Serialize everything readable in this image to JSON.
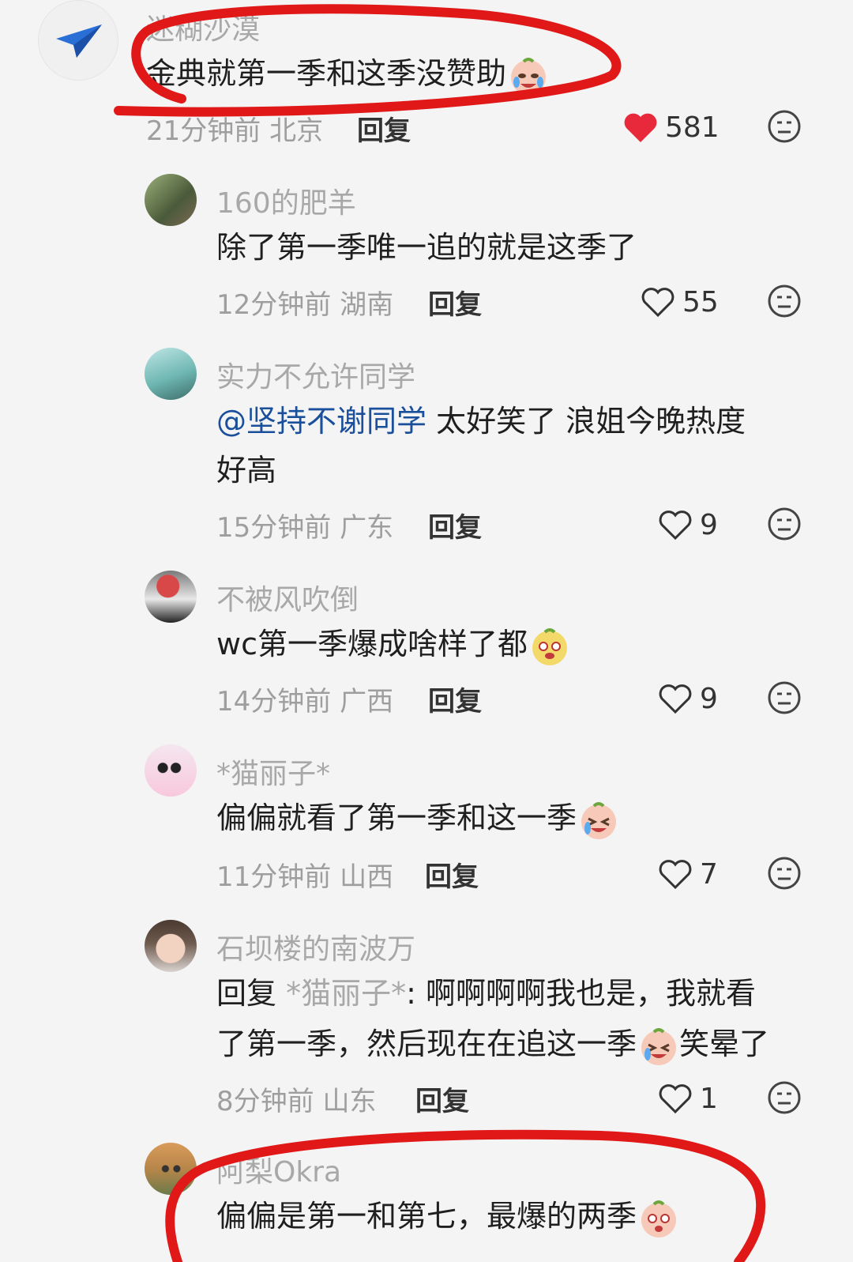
{
  "comments": [
    {
      "username": "迷糊沙漠",
      "text": "金典就第一季和这季没赞助",
      "time": "21分钟前",
      "location": "北京",
      "reply": "回复",
      "likes": "581",
      "liked": true
    },
    {
      "username": "160的肥羊",
      "text": "除了第一季唯一追的就是这季了",
      "time": "12分钟前",
      "location": "湖南",
      "reply": "回复",
      "likes": "55",
      "liked": false
    },
    {
      "username": "实力不允许同学",
      "mention": "@坚持不谢同学",
      "text": " 太好笑了  浪姐今晚热度",
      "text2": "好高",
      "time": "15分钟前",
      "location": "广东",
      "reply": "回复",
      "likes": "9",
      "liked": false
    },
    {
      "username": "不被风吹倒",
      "text": "wc第一季爆成啥样了都",
      "time": "14分钟前",
      "location": "广西",
      "reply": "回复",
      "likes": "9",
      "liked": false
    },
    {
      "username": "*猫丽子*",
      "text": "偏偏就看了第一季和这一季",
      "time": "11分钟前",
      "location": "山西",
      "reply": "回复",
      "likes": "7",
      "liked": false
    },
    {
      "username": "石坝楼的南波万",
      "reply_prefix": "回复 ",
      "reply_to": "*猫丽子*",
      "text": ": 啊啊啊啊我也是，我就看",
      "text2": "了第一季，然后现在在追这一季",
      "text2b": "笑晕了",
      "time": "8分钟前",
      "location": "山东",
      "reply": "回复",
      "likes": "1",
      "liked": false
    },
    {
      "username": "阿梨Okra",
      "text": "偏偏是第一和第七，最爆的两季"
    }
  ],
  "colors": {
    "liked": "#e8293b",
    "annotation": "#e01818",
    "mention": "#1a4f9c"
  },
  "icons": {
    "like": "heart-icon",
    "dislike": "meh-face-icon",
    "emoji": "crying-laughing-emoji-icon"
  }
}
